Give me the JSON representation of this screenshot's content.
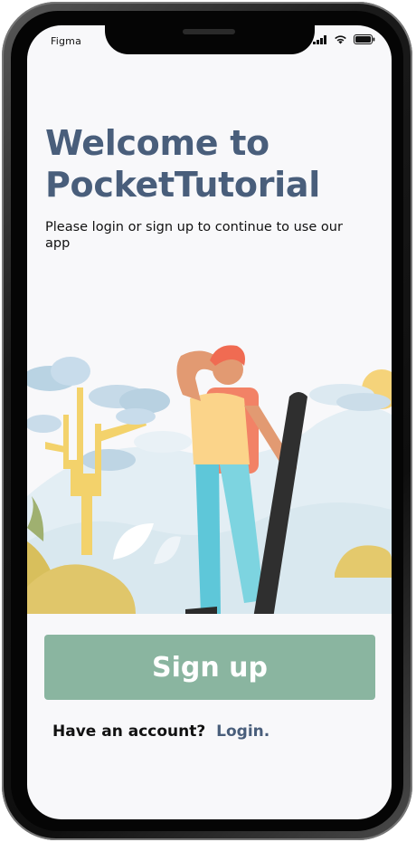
{
  "status_bar": {
    "carrier": "Figma",
    "icons": [
      "signal-icon",
      "wifi-icon",
      "battery-icon"
    ]
  },
  "welcome": {
    "title_line1": "Welcome to",
    "title_line2": "PocketTutorial",
    "subtitle": "Please login or sign up to continue to use our app"
  },
  "actions": {
    "signup_label": "Sign up",
    "account_prompt": "Have an account?",
    "login_label": "Login."
  },
  "colors": {
    "title": "#495e7b",
    "signup_button": "#8ab5a0",
    "login_link": "#495e7b",
    "screen_background": "#f8f8fa"
  }
}
